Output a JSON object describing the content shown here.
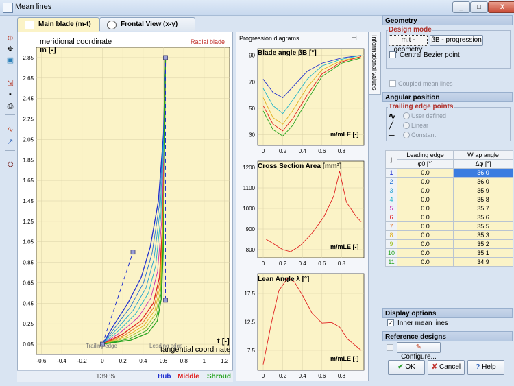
{
  "window": {
    "title": "Mean lines",
    "controls": [
      "_",
      "□",
      "X"
    ]
  },
  "tabs": [
    {
      "label": "Main blade (m-t)",
      "active": true
    },
    {
      "label": "Frontal View (x-y)",
      "active": false
    }
  ],
  "toolbar": {
    "icons": [
      "zoom-in-icon",
      "move-icon",
      "fit-icon",
      "export-icon",
      "save-icon",
      "print-icon",
      "curve-icon",
      "pick-icon",
      "settings-icon"
    ]
  },
  "main_plot": {
    "ylabel_top": "meridional coordinate",
    "ylabel_unit": "m [-]",
    "xlabel_unit": "t [-]",
    "xlabel": "tangential coordinate",
    "badge": "Radial blade",
    "trailing_edge": "Trailing edge",
    "leading_edge": "Leading edge",
    "chart_data": {
      "type": "line",
      "x_ticks": [
        "-0.6",
        "-0.4",
        "-0.2",
        "0",
        "0.2",
        "0.4",
        "0.6",
        "0.8",
        "1",
        "1.2"
      ],
      "y_ticks": [
        "0.05",
        "0.25",
        "0.45",
        "0.65",
        "0.85",
        "1.05",
        "1.25",
        "1.45",
        "1.65",
        "1.85",
        "2.05",
        "2.25",
        "2.45",
        "2.65",
        "2.85"
      ],
      "xlim": [
        -0.65,
        1.25
      ],
      "ylim": [
        -0.05,
        2.95
      ],
      "series": [
        {
          "name": "Hub",
          "color": "#1f2fd0",
          "x": [
            0.0,
            0.12,
            0.25,
            0.38,
            0.47,
            0.55,
            0.6,
            0.62
          ],
          "y": [
            0.05,
            0.25,
            0.45,
            0.7,
            1.0,
            1.45,
            2.1,
            2.85
          ]
        },
        {
          "name": "Middle",
          "color": "#e01f1f",
          "x": [
            0.0,
            0.2,
            0.38,
            0.5,
            0.56,
            0.59,
            0.61,
            0.62
          ],
          "y": [
            0.05,
            0.15,
            0.28,
            0.45,
            0.7,
            1.2,
            2.0,
            2.85
          ]
        },
        {
          "name": "Shroud",
          "color": "#24a31d",
          "x": [
            0.0,
            0.28,
            0.45,
            0.54,
            0.58,
            0.6,
            0.61,
            0.62
          ],
          "y": [
            0.05,
            0.09,
            0.16,
            0.28,
            0.5,
            1.0,
            1.9,
            2.85
          ]
        }
      ],
      "control_points": [
        [
          0.3,
          0.95
        ],
        [
          0.62,
          0.48
        ],
        [
          0.62,
          2.85
        ],
        [
          0.0,
          0.05
        ]
      ]
    }
  },
  "status": {
    "zoom": "139 %",
    "legend": [
      {
        "label": "Hub",
        "color": "#1f2fd0"
      },
      {
        "label": "Middle",
        "color": "#e01f1f"
      },
      {
        "label": "Shroud",
        "color": "#24a31d"
      }
    ]
  },
  "progression": {
    "title": "Progression diagrams",
    "side_tab": "Informational values",
    "charts": [
      {
        "title": "Blade angle βB [°]",
        "xlabel": "m/mLE [-]",
        "chart_data": {
          "type": "line",
          "x_ticks": [
            "0",
            "0.2",
            "0.4",
            "0.6",
            "0.8"
          ],
          "y_ticks": [
            "30",
            "50",
            "70",
            "90"
          ],
          "ylim": [
            22,
            95
          ],
          "series": [
            {
              "color": "#1f2fd0",
              "x": [
                0,
                0.1,
                0.2,
                0.3,
                0.45,
                0.6,
                0.8,
                1.0
              ],
              "y": [
                72,
                62,
                58,
                66,
                78,
                84,
                88,
                90
              ]
            },
            {
              "color": "#1fb3c9",
              "x": [
                0,
                0.1,
                0.2,
                0.3,
                0.45,
                0.6,
                0.8,
                1.0
              ],
              "y": [
                65,
                52,
                46,
                56,
                72,
                82,
                87,
                90
              ]
            },
            {
              "color": "#e0b01f",
              "x": [
                0,
                0.1,
                0.2,
                0.3,
                0.45,
                0.6,
                0.8,
                1.0
              ],
              "y": [
                58,
                43,
                38,
                48,
                66,
                79,
                86,
                89
              ]
            },
            {
              "color": "#e01f1f",
              "x": [
                0,
                0.1,
                0.2,
                0.3,
                0.45,
                0.6,
                0.8,
                1.0
              ],
              "y": [
                52,
                38,
                33,
                42,
                60,
                76,
                85,
                89
              ]
            },
            {
              "color": "#24a31d",
              "x": [
                0,
                0.1,
                0.2,
                0.3,
                0.45,
                0.6,
                0.8,
                1.0
              ],
              "y": [
                48,
                34,
                29,
                37,
                56,
                74,
                84,
                88
              ]
            }
          ]
        }
      },
      {
        "title": "Cross Section Area [mm²]",
        "xlabel": "m/mLE [-]",
        "chart_data": {
          "type": "line",
          "x_ticks": [
            "0",
            "0.2",
            "0.4",
            "0.6",
            "0.8"
          ],
          "y_ticks": [
            "800",
            "900",
            "1000",
            "1100",
            "1200"
          ],
          "ylim": [
            760,
            1230
          ],
          "series": [
            {
              "color": "#e01f1f",
              "x": [
                0.03,
                0.1,
                0.2,
                0.28,
                0.38,
                0.5,
                0.62,
                0.72,
                0.78,
                0.85,
                0.95,
                1.0
              ],
              "y": [
                850,
                830,
                800,
                790,
                820,
                880,
                960,
                1060,
                1180,
                1030,
                960,
                935
              ]
            }
          ]
        }
      },
      {
        "title": "Lean Angle λ [°]",
        "xlabel": "m/mLE [-]",
        "chart_data": {
          "type": "line",
          "x_ticks": [
            "0",
            "0.2",
            "0.4",
            "0.6",
            "0.8"
          ],
          "y_ticks": [
            "7.5",
            "12.5",
            "17.5"
          ],
          "ylim": [
            4,
            21
          ],
          "series": [
            {
              "color": "#e01f1f",
              "x": [
                0.0,
                0.08,
                0.16,
                0.25,
                0.32,
                0.4,
                0.5,
                0.6,
                0.7,
                0.78,
                0.86,
                1.0
              ],
              "y": [
                5,
                12,
                18,
                20.2,
                19.5,
                17.2,
                14,
                12.3,
                12.4,
                11.6,
                9.5,
                7.5
              ]
            }
          ]
        }
      }
    ]
  },
  "geometry": {
    "header": "Geometry",
    "design_mode_title": "Design mode",
    "btn_mt": "m,t - geometry",
    "btn_beta": "βB - progression",
    "central_bezier": "Central Bezier point",
    "coupled": "Coupled mean lines"
  },
  "angular": {
    "header": "Angular position",
    "te_title": "Trailing edge points",
    "options": [
      "User defined",
      "Linear",
      "Constant"
    ],
    "table": {
      "col_j": "j",
      "col_le": "Leading edge",
      "col_wa": "Wrap angle",
      "sub_le": "φ0 [°]",
      "sub_wa": "Δφ [°]",
      "rows": [
        {
          "j": "1",
          "le": "0.0",
          "wa": "36.0",
          "color": "#1f2fd0"
        },
        {
          "j": "2",
          "le": "0.0",
          "wa": "36.0",
          "color": "#1f6fd0"
        },
        {
          "j": "3",
          "le": "0.0",
          "wa": "35.9",
          "color": "#1f9fd0"
        },
        {
          "j": "4",
          "le": "0.0",
          "wa": "35.8",
          "color": "#1fb3c9"
        },
        {
          "j": "5",
          "le": "0.0",
          "wa": "35.7",
          "color": "#c92fb0"
        },
        {
          "j": "6",
          "le": "0.0",
          "wa": "35.6",
          "color": "#e01f1f"
        },
        {
          "j": "7",
          "le": "0.0",
          "wa": "35.5",
          "color": "#e06f1f"
        },
        {
          "j": "8",
          "le": "0.0",
          "wa": "35.3",
          "color": "#e0b01f"
        },
        {
          "j": "9",
          "le": "0.0",
          "wa": "35.2",
          "color": "#a0c01f"
        },
        {
          "j": "10",
          "le": "0.0",
          "wa": "35.1",
          "color": "#24a31d"
        },
        {
          "j": "11",
          "le": "0.0",
          "wa": "34.9",
          "color": "#24a31d"
        }
      ]
    }
  },
  "display": {
    "header": "Display options",
    "inner": "Inner mean lines"
  },
  "reference": {
    "header": "Reference designs",
    "configure": "Configure..."
  },
  "footer": {
    "ok": "OK",
    "cancel": "Cancel",
    "help": "Help"
  }
}
